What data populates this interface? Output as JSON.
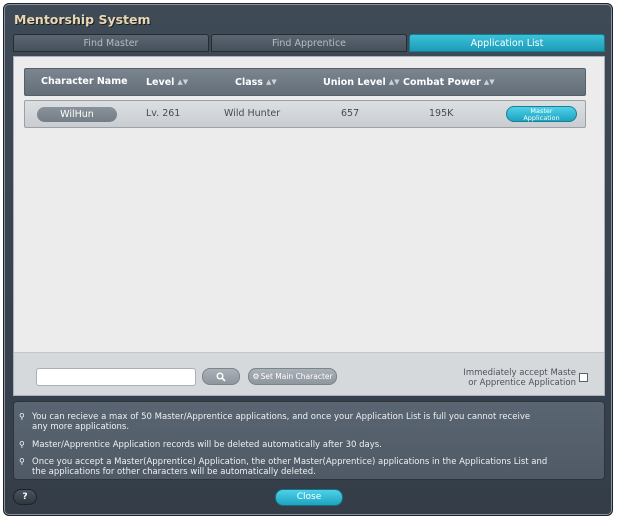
{
  "window": {
    "title": "Mentorship System"
  },
  "tabs": [
    {
      "label": "Find Master",
      "active": false
    },
    {
      "label": "Find Apprentice",
      "active": false
    },
    {
      "label": "Application List",
      "active": true
    }
  ],
  "table": {
    "columns": {
      "name": "Character Name",
      "level": "Level",
      "class": "Class",
      "union": "Union Level",
      "power": "Combat Power"
    },
    "rows": [
      {
        "name": "WilHun",
        "level": "Lv. 261",
        "class": "Wild Hunter",
        "union": "657",
        "power": "195K",
        "action_line1": "Master",
        "action_line2": "Application"
      }
    ]
  },
  "controls": {
    "search_value": "",
    "search_placeholder": "",
    "set_main_label": "Set Main Character",
    "auto_accept_line1": "Immediately accept Maste",
    "auto_accept_line2": "or Apprentice Application",
    "auto_accept_checked": false
  },
  "notes": [
    {
      "line1": "You can recieve a max of 50 Master/Apprentice applications, and once your Application List is full you cannot receive",
      "line2": "any more applications."
    },
    {
      "line1": "Master/Apprentice Application records will be deleted automatically after 30 days."
    },
    {
      "line1": "Once you accept a Master(Apprentice) Application, the other Master(Apprentice) applications in the Applications List and",
      "line2": "the applications for other characters will be automatically deleted."
    }
  ],
  "footer": {
    "help_label": "?",
    "close_label": "Close"
  },
  "colors": {
    "accent": "#1ea3c0",
    "title": "#e8d7b2",
    "window_bg": "#3f4a57"
  }
}
